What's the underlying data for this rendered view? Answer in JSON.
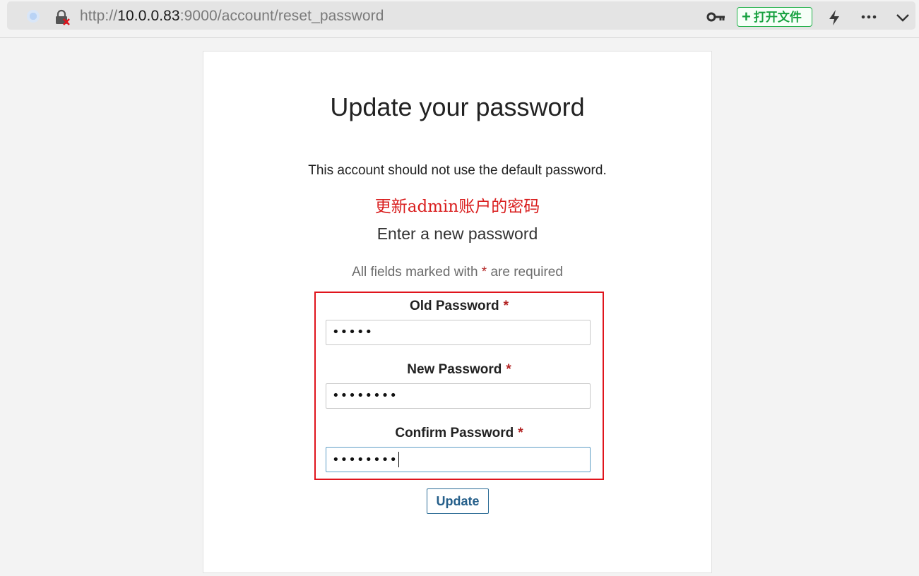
{
  "browser": {
    "url_prefix": "http://",
    "url_host": "10.0.0.83",
    "url_rest": ":9000/account/reset_password",
    "open_file_label": "打开文件",
    "icons": [
      "site-icon",
      "insecure-lock-icon",
      "key-icon",
      "plus-icon",
      "lightning-icon",
      "more-icon",
      "chevron-down-icon"
    ]
  },
  "page": {
    "title": "Update your password",
    "note": "This account should not use the default password.",
    "annotation": "更新admin账户的密码",
    "subtitle": "Enter a new password",
    "required_prefix": "All fields marked with",
    "required_star": "*",
    "required_suffix": "are required"
  },
  "form": {
    "old_password": {
      "label": "Old Password",
      "star": "*",
      "value": "•••••"
    },
    "new_password": {
      "label": "New Password",
      "star": "*",
      "value": "••••••••"
    },
    "confirm_password": {
      "label": "Confirm Password",
      "star": "*",
      "value": "••••••••"
    },
    "update_label": "Update"
  },
  "colors": {
    "annotation_red": "#d91e1e",
    "highlight_border": "#e0141c",
    "required_star": "#b22222",
    "button_blue": "#255f8a",
    "open_file_green": "#16a13f"
  }
}
